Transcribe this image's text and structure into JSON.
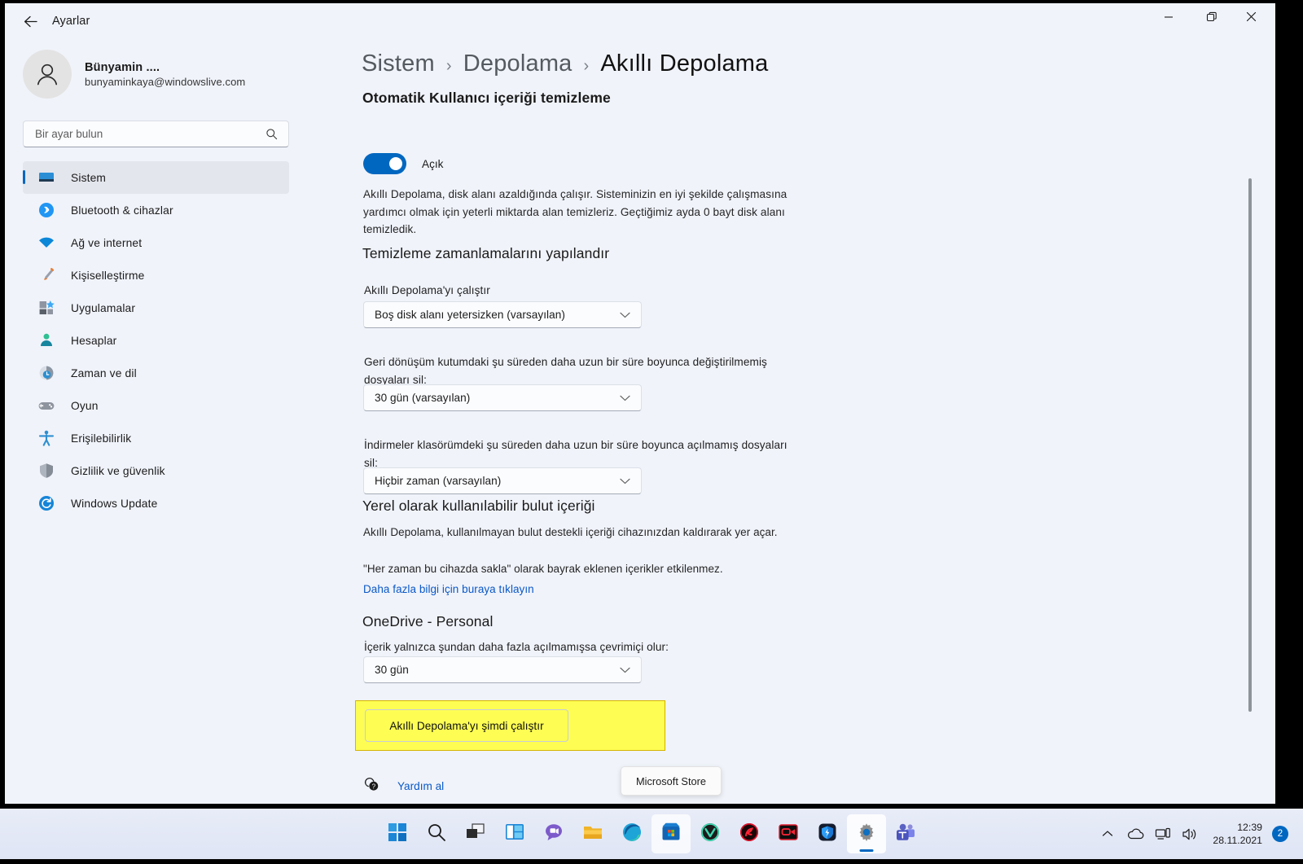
{
  "window": {
    "app_title": "Ayarlar",
    "back_icon": "back-arrow-icon",
    "minimize_icon": "minimize-icon",
    "maximize_icon": "restore-icon",
    "close_icon": "close-icon"
  },
  "sidebar": {
    "account": {
      "name": "Bünyamin ....",
      "email": "bunyaminkaya@windowslive.com",
      "avatar_icon": "person-avatar-icon"
    },
    "search": {
      "placeholder": "Bir ayar bulun",
      "value": "",
      "icon": "search-icon"
    },
    "items": [
      {
        "label": "Sistem",
        "icon": "monitor-icon",
        "selected": true
      },
      {
        "label": "Bluetooth & cihazlar",
        "icon": "bluetooth-icon",
        "selected": false
      },
      {
        "label": "Ağ ve internet",
        "icon": "wifi-icon",
        "selected": false
      },
      {
        "label": "Kişiselleştirme",
        "icon": "paintbrush-icon",
        "selected": false
      },
      {
        "label": "Uygulamalar",
        "icon": "apps-icon",
        "selected": false
      },
      {
        "label": "Hesaplar",
        "icon": "accounts-person-icon",
        "selected": false
      },
      {
        "label": "Zaman ve dil",
        "icon": "clock-globe-icon",
        "selected": false
      },
      {
        "label": "Oyun",
        "icon": "gamepad-icon",
        "selected": false
      },
      {
        "label": "Erişilebilirlik",
        "icon": "accessibility-person-icon",
        "selected": false
      },
      {
        "label": "Gizlilik ve güvenlik",
        "icon": "shield-icon",
        "selected": false
      },
      {
        "label": "Windows Update",
        "icon": "update-refresh-icon",
        "selected": false
      }
    ]
  },
  "main": {
    "breadcrumb": {
      "root": "Sistem",
      "parent": "Depolama",
      "current": "Akıllı Depolama",
      "separator": "›"
    },
    "section_title": "Otomatik Kullanıcı içeriği temizleme",
    "toggle": {
      "label": "Açık",
      "state": "on",
      "accent_color": "#0067C0"
    },
    "toggle_description": "Akıllı Depolama, disk alanı azaldığında çalışır. Sisteminizin en iyi şekilde çalışmasına yardımcı olmak için yeterli miktarda alan temizleriz. Geçtiğimiz ayda 0 bayt disk alanı temizledik.",
    "schedules": {
      "heading": "Temizleme zamanlamalarını yapılandır",
      "fields": [
        {
          "label": "Akıllı Depolama'yı çalıştır",
          "value": "Boş disk alanı yetersizken (varsayılan)",
          "chevron_icon": "chevron-down-icon"
        },
        {
          "label": "Geri dönüşüm kutumdaki şu süreden daha uzun bir süre boyunca değiştirilmemiş dosyaları sil:",
          "value": "30 gün (varsayılan)",
          "chevron_icon": "chevron-down-icon"
        },
        {
          "label": "İndirmeler klasörümdeki şu süreden daha uzun bir süre boyunca açılmamış dosyaları sil:",
          "value": "Hiçbir zaman (varsayılan)",
          "chevron_icon": "chevron-down-icon"
        }
      ]
    },
    "cloud": {
      "heading": "Yerel olarak kullanılabilir bulut içeriği",
      "paragraph1": "Akıllı Depolama, kullanılmayan bulut destekli içeriği cihazınızdan kaldırarak yer açar.",
      "paragraph2": "\"Her zaman bu cihazda sakla\" olarak bayrak eklenen içerikler etkilenmez.",
      "link": "Daha fazla bilgi için buraya tıklayın"
    },
    "onedrive": {
      "title": "OneDrive - Personal",
      "field_label": "İçerik yalnızca şundan daha fazla açılmamışsa çevrimiçi olur:",
      "value": "30 gün",
      "chevron_icon": "chevron-down-icon"
    },
    "run_now_button": {
      "label": "Akıllı Depolama'yı şimdi çalıştır",
      "highlight_color": "#FDFD54",
      "highlight_border_color": "#D6B400"
    },
    "help": {
      "label": "Yardım al",
      "icon": "help-question-icon"
    }
  },
  "tooltip": {
    "text": "Microsoft Store"
  },
  "taskbar": {
    "items": [
      {
        "name": "start",
        "icon": "windows-start-icon",
        "state": "normal"
      },
      {
        "name": "search",
        "icon": "search-icon",
        "state": "normal"
      },
      {
        "name": "task-view",
        "icon": "task-view-icon",
        "state": "normal"
      },
      {
        "name": "widgets",
        "icon": "widgets-icon",
        "state": "normal"
      },
      {
        "name": "chat",
        "icon": "chat-icon",
        "state": "normal"
      },
      {
        "name": "file-explorer",
        "icon": "folder-icon",
        "state": "normal"
      },
      {
        "name": "edge",
        "icon": "edge-browser-icon",
        "state": "normal"
      },
      {
        "name": "microsoft-store",
        "icon": "store-icon",
        "state": "hover"
      },
      {
        "name": "vivaldi",
        "icon": "vivaldi-icon",
        "state": "normal"
      },
      {
        "name": "red-app",
        "icon": "red-circle-app-icon",
        "state": "normal"
      },
      {
        "name": "screen-recorder",
        "icon": "recorder-icon",
        "state": "normal"
      },
      {
        "name": "blue-shield-app",
        "icon": "blue-shield-app-icon",
        "state": "normal"
      },
      {
        "name": "settings",
        "icon": "gear-icon",
        "state": "active"
      },
      {
        "name": "teams",
        "icon": "teams-icon",
        "state": "normal"
      }
    ],
    "tray": {
      "overflow_icon": "chevron-up-icon",
      "onedrive_icon": "cloud-icon",
      "network_icon": "network-icon",
      "volume_icon": "speaker-icon",
      "time": "12:39",
      "date": "28.11.2021",
      "notification_count": "2",
      "badge_color": "#0067C0"
    }
  }
}
